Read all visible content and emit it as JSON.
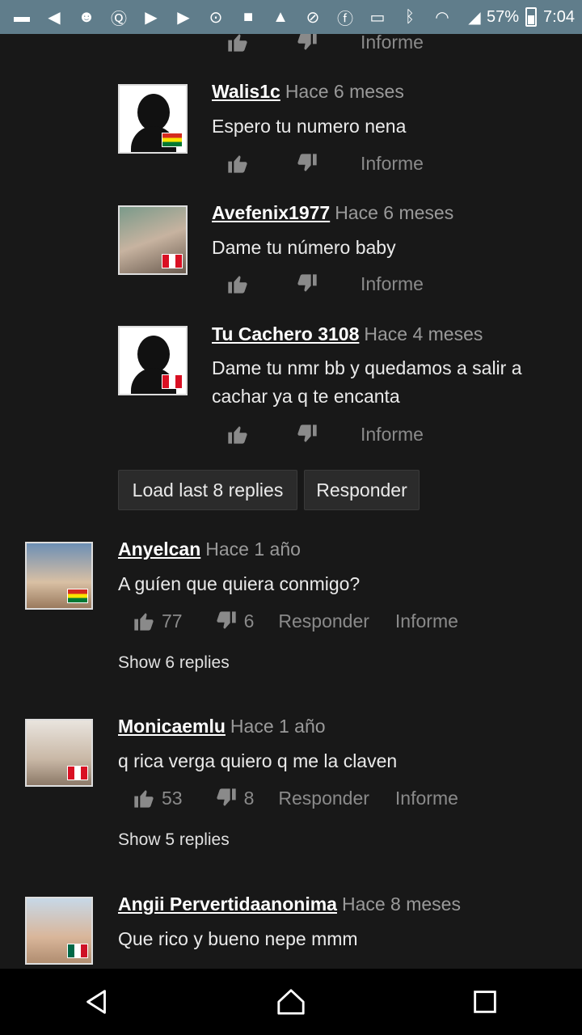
{
  "status_bar": {
    "icons": [
      "messages-icon",
      "volume-icon",
      "android-icon",
      "quora-icon",
      "youtube-icon",
      "youtube-icon",
      "hotspot-icon",
      "video-icon",
      "warning-icon",
      "do-not-disturb-icon",
      "facebook-icon",
      "cast-icon",
      "bluetooth-icon",
      "wifi-icon",
      "signal-icon"
    ],
    "battery": "57%",
    "time": "7:04"
  },
  "labels": {
    "report": "Informe",
    "reply": "Responder"
  },
  "replies": [
    {
      "user": "Walis1c",
      "time": "Hace 6 meses",
      "text": "Espero tu numero nena",
      "flag": "bo",
      "avatar": "silhouette"
    },
    {
      "user": "Avefenix1977",
      "time": "Hace 6 meses",
      "text": "Dame tu número baby",
      "flag": "pe",
      "avatar": "photo"
    },
    {
      "user": "Tu Cachero 3108",
      "time": "Hace 4 meses",
      "text": "Dame tu nmr bb y quedamos a salir a cachar ya q te encanta",
      "flag": "pe",
      "avatar": "silhouette"
    }
  ],
  "thread_buttons": {
    "load_more": "Load last 8 replies",
    "reply": "Responder"
  },
  "comments": [
    {
      "user": "Anyelcan",
      "time": "Hace 1 año",
      "text": "A guíen que quiera conmigo?",
      "likes": "77",
      "dislikes": "6",
      "show_replies": "Show 6 replies",
      "flag": "bo"
    },
    {
      "user": "Monicaemlu",
      "time": "Hace 1 año",
      "text": "q rica verga quiero q me la claven",
      "likes": "53",
      "dislikes": "8",
      "show_replies": "Show 5 replies",
      "flag": "pe"
    },
    {
      "user": "Angii Pervertidaanonima",
      "time": "Hace 8 meses",
      "text": "Que rico y bueno nepe mmm",
      "flag": "mx"
    }
  ]
}
